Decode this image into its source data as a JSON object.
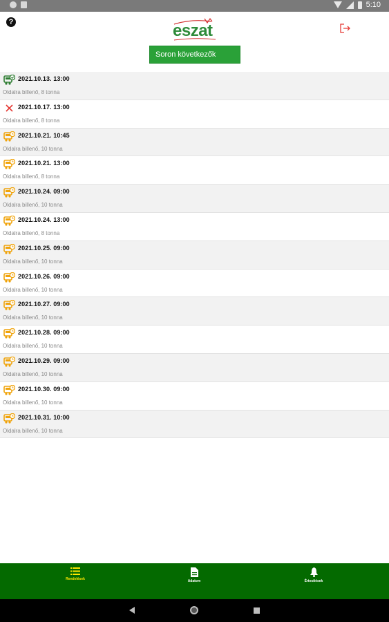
{
  "status_bar": {
    "time": "5:10"
  },
  "header": {
    "logo_text": "eszat",
    "primary_button_label": "Soron következők",
    "help_icon": "question-circle-icon",
    "logout_icon": "logout-icon"
  },
  "colors": {
    "brand_green": "#2aa138",
    "nav_green": "#046a00",
    "active_yellow": "#ffe600",
    "status_orange": "#f0a30a",
    "cancel_red": "#e53935"
  },
  "items": [
    {
      "date": "2021.10.13. 13:00",
      "desc": "Oldalra billenő, 8 tonna",
      "status": "done"
    },
    {
      "date": "2021.10.17. 13:00",
      "desc": "Oldalra billenő, 8 tonna",
      "status": "cancelled"
    },
    {
      "date": "2021.10.21. 10:45",
      "desc": "Oldalra billenő, 10 tonna",
      "status": "pending"
    },
    {
      "date": "2021.10.21. 13:00",
      "desc": "Oldalra billenő, 8 tonna",
      "status": "pending"
    },
    {
      "date": "2021.10.24. 09:00",
      "desc": "Oldalra billenő, 10 tonna",
      "status": "pending"
    },
    {
      "date": "2021.10.24. 13:00",
      "desc": "Oldalra billenő, 8 tonna",
      "status": "pending"
    },
    {
      "date": "2021.10.25. 09:00",
      "desc": "Oldalra billenő, 10 tonna",
      "status": "pending"
    },
    {
      "date": "2021.10.26. 09:00",
      "desc": "Oldalra billenő, 10 tonna",
      "status": "pending"
    },
    {
      "date": "2021.10.27. 09:00",
      "desc": "Oldalra billenő, 10 tonna",
      "status": "pending"
    },
    {
      "date": "2021.10.28. 09:00",
      "desc": "Oldalra billenő, 10 tonna",
      "status": "pending"
    },
    {
      "date": "2021.10.29. 09:00",
      "desc": "Oldalra billenő, 10 tonna",
      "status": "pending"
    },
    {
      "date": "2021.10.30. 09:00",
      "desc": "Oldalra billenő, 10 tonna",
      "status": "pending"
    },
    {
      "date": "2021.10.31. 10:00",
      "desc": "Oldalra billenő, 10 tonna",
      "status": "pending"
    }
  ],
  "bottom_nav": [
    {
      "label": "Rendelések",
      "icon": "list-icon",
      "active": true
    },
    {
      "label": "Adatom",
      "icon": "document-icon",
      "active": false
    },
    {
      "label": "Értesítések",
      "icon": "bell-icon",
      "active": false
    }
  ]
}
